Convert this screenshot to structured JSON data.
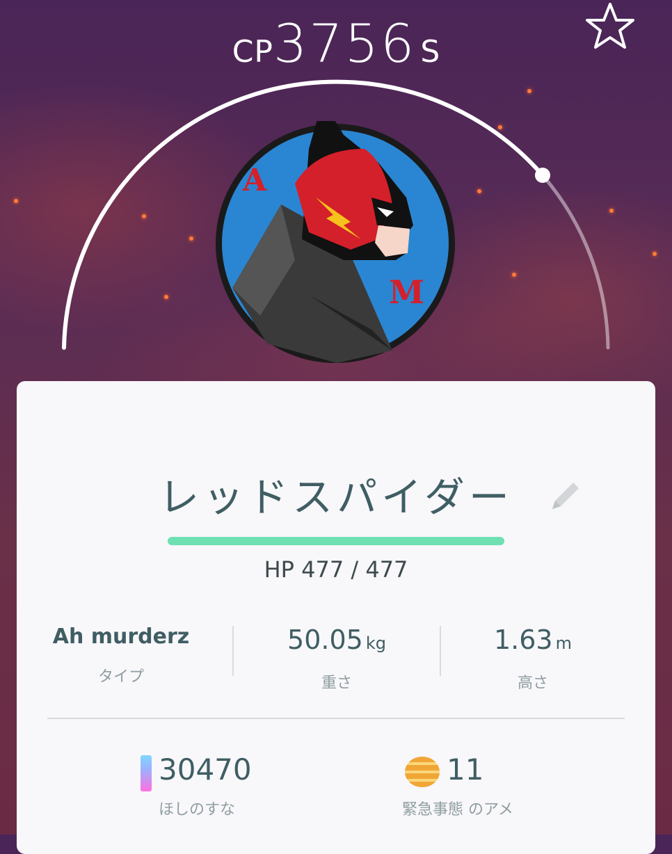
{
  "header": {
    "cp_prefix": "CP",
    "cp_value": "3756",
    "cp_suffix": "S"
  },
  "pokemon": {
    "name": "レッドスパイダー",
    "hp_text": "HP 477 / 477",
    "hp_current": 477,
    "hp_max": 477
  },
  "stats": {
    "type_value": "Ah murderz",
    "type_label": "タイプ",
    "weight_value": "50.05",
    "weight_unit": "kg",
    "weight_label": "重さ",
    "height_value": "1.63",
    "height_unit": "m",
    "height_label": "高さ"
  },
  "resources": {
    "stardust_value": "30470",
    "stardust_label": "ほしのすな",
    "candy_value": "11",
    "candy_label": "緊急事態 のアメ"
  },
  "colors": {
    "hp_bar": "#6fe0b2",
    "text_teal": "#3f5e63",
    "avatar_blue": "#2a86d2",
    "avatar_red": "#d4202a"
  },
  "icons": {
    "favorite": "star-icon",
    "edit": "pencil-icon",
    "stardust": "stardust-icon",
    "candy": "candy-icon"
  }
}
